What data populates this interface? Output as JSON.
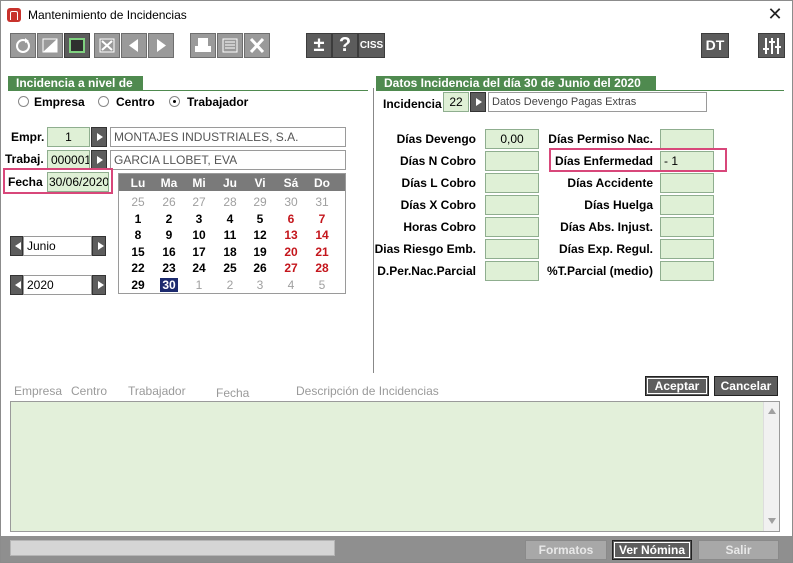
{
  "window": {
    "title": "Mantenimiento de Incidencias",
    "close_glyph": "✕"
  },
  "toolbar": {
    "left_icons": [
      "refresh-icon",
      "edit-icon",
      "square-icon",
      "cancel-icon",
      "prev-icon",
      "next-icon",
      "print-icon",
      "list-icon",
      "excel-icon"
    ],
    "plusminus_label": "±",
    "help_label": "?",
    "ciss_label": "CISS",
    "dt_label": "DT",
    "settings_icon": "sliders-icon"
  },
  "left_section": {
    "title": "Incidencia a nivel de",
    "radios": [
      {
        "label": "Empresa",
        "selected": false
      },
      {
        "label": "Centro",
        "selected": false
      },
      {
        "label": "Trabajador",
        "selected": true
      }
    ],
    "empresa": {
      "label": "Empr.",
      "code": "1",
      "name": "MONTAJES INDUSTRIALES, S.A."
    },
    "trabajador": {
      "label": "Trabaj.",
      "code": "000001",
      "name": "GARCIA LLOBET, EVA"
    },
    "fecha": {
      "label": "Fecha",
      "value": "30/06/2020"
    },
    "month": "Junio",
    "year": "2020"
  },
  "calendar": {
    "headers": [
      "Lu",
      "Ma",
      "Mi",
      "Ju",
      "Vi",
      "Sá",
      "Do"
    ],
    "weeks": [
      [
        {
          "d": "25",
          "t": "o"
        },
        {
          "d": "26",
          "t": "o"
        },
        {
          "d": "27",
          "t": "o"
        },
        {
          "d": "28",
          "t": "o"
        },
        {
          "d": "29",
          "t": "o"
        },
        {
          "d": "30",
          "t": "o"
        },
        {
          "d": "31",
          "t": "o"
        }
      ],
      [
        {
          "d": "1",
          "t": "n"
        },
        {
          "d": "2",
          "t": "n"
        },
        {
          "d": "3",
          "t": "n"
        },
        {
          "d": "4",
          "t": "n"
        },
        {
          "d": "5",
          "t": "n"
        },
        {
          "d": "6",
          "t": "r"
        },
        {
          "d": "7",
          "t": "r"
        }
      ],
      [
        {
          "d": "8",
          "t": "n"
        },
        {
          "d": "9",
          "t": "n"
        },
        {
          "d": "10",
          "t": "n"
        },
        {
          "d": "11",
          "t": "n"
        },
        {
          "d": "12",
          "t": "n"
        },
        {
          "d": "13",
          "t": "r"
        },
        {
          "d": "14",
          "t": "r"
        }
      ],
      [
        {
          "d": "15",
          "t": "n"
        },
        {
          "d": "16",
          "t": "n"
        },
        {
          "d": "17",
          "t": "n"
        },
        {
          "d": "18",
          "t": "n"
        },
        {
          "d": "19",
          "t": "n"
        },
        {
          "d": "20",
          "t": "r"
        },
        {
          "d": "21",
          "t": "r"
        }
      ],
      [
        {
          "d": "22",
          "t": "n"
        },
        {
          "d": "23",
          "t": "n"
        },
        {
          "d": "24",
          "t": "n"
        },
        {
          "d": "25",
          "t": "n"
        },
        {
          "d": "26",
          "t": "n"
        },
        {
          "d": "27",
          "t": "r"
        },
        {
          "d": "28",
          "t": "r"
        }
      ],
      [
        {
          "d": "29",
          "t": "n"
        },
        {
          "d": "30",
          "t": "sel"
        },
        {
          "d": "1",
          "t": "o"
        },
        {
          "d": "2",
          "t": "o"
        },
        {
          "d": "3",
          "t": "o"
        },
        {
          "d": "4",
          "t": "o"
        },
        {
          "d": "5",
          "t": "o"
        }
      ]
    ]
  },
  "right_section": {
    "title": "Datos Incidencia del día 30 de Junio del 2020",
    "incidencia": {
      "label": "Incidencia",
      "code": "22",
      "description": "Datos Devengo Pagas Extras"
    },
    "left_fields": [
      {
        "label": "Días Devengo",
        "value": "0,00"
      },
      {
        "label": "Días N Cobro",
        "value": ""
      },
      {
        "label": "Días L Cobro",
        "value": ""
      },
      {
        "label": "Días X Cobro",
        "value": ""
      },
      {
        "label": "Horas Cobro",
        "value": ""
      },
      {
        "label": "Dias Riesgo Emb.",
        "value": ""
      },
      {
        "label": "D.Per.Nac.Parcial",
        "value": ""
      }
    ],
    "right_fields": [
      {
        "label": "Días Permiso Nac.",
        "value": ""
      },
      {
        "label": "Días Enfermedad",
        "value": "- 1"
      },
      {
        "label": "Días Accidente",
        "value": ""
      },
      {
        "label": "Días Huelga",
        "value": ""
      },
      {
        "label": "Días Abs. Injust.",
        "value": ""
      },
      {
        "label": "Días Exp. Regul.",
        "value": ""
      },
      {
        "label": "%T.Parcial (medio)",
        "value": ""
      }
    ]
  },
  "actions": {
    "accept": "Aceptar",
    "cancel": "Cancelar"
  },
  "list": {
    "columns": [
      "Empresa",
      "Centro",
      "Trabajador",
      "Fecha",
      "Descripción de Incidencias"
    ]
  },
  "footer": {
    "formatos": "Formatos",
    "ver_nomina": "Ver Nómina",
    "salir": "Salir"
  },
  "colors": {
    "section_green": "#4f8a4f",
    "field_green": "#dff0d6",
    "highlight": "#d8477a",
    "weekend_red": "#c4161c"
  }
}
